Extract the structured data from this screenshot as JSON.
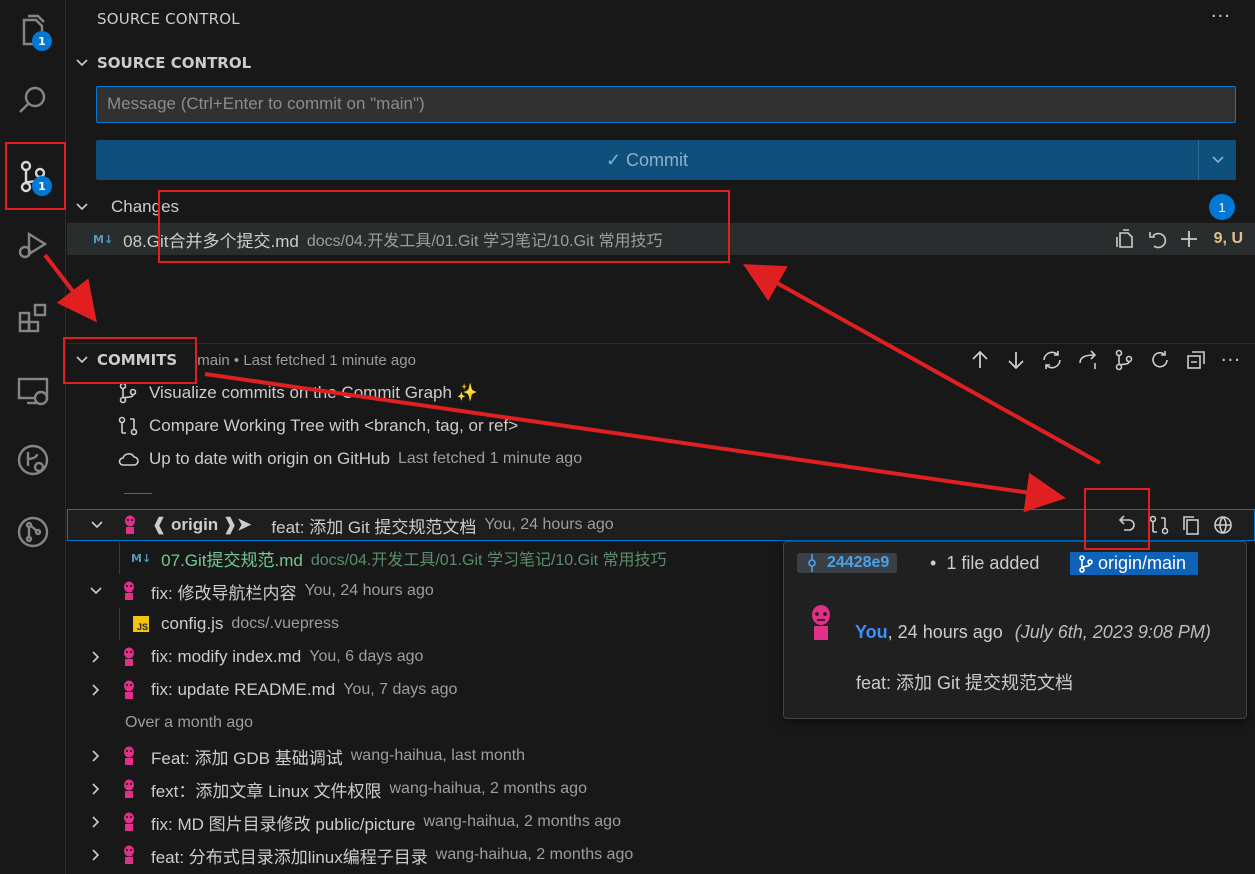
{
  "activity_bar": {
    "items": [
      {
        "icon": "files-icon",
        "badge": "1"
      },
      {
        "icon": "search-icon"
      },
      {
        "icon": "source-control-icon",
        "badge": "1"
      },
      {
        "icon": "run-debug-icon"
      },
      {
        "icon": "extensions-icon"
      },
      {
        "icon": "remote-explorer-icon"
      },
      {
        "icon": "gitlens-inspect-icon"
      },
      {
        "icon": "gitlens-icon"
      }
    ]
  },
  "view": {
    "title": "SOURCE CONTROL",
    "more": "···"
  },
  "scm": {
    "section_title": "SOURCE CONTROL",
    "message_placeholder": "Message (Ctrl+Enter to commit on \"main\")",
    "commit_label": "✓ Commit",
    "changes_label": "Changes",
    "changes_count": "1",
    "changed_file": {
      "name": "08.Git合并多个提交.md",
      "path": "docs/04.开发工具/01.Git 学习笔记/10.Git 常用技巧",
      "status": "9, U",
      "icon_text": "M↓"
    }
  },
  "commits": {
    "section_title": "COMMITS",
    "subtitle": "main • Last fetched 1 minute ago",
    "actions": [
      {
        "label": "Visualize commits on the Commit Graph ✨",
        "icon": "graph-icon"
      },
      {
        "label": "Compare Working Tree with <branch, tag, or ref>",
        "icon": "compare-icon"
      },
      {
        "label": "Up to date with origin on GitHub",
        "detail": "Last fetched 1 minute ago",
        "icon": "cloud-icon"
      }
    ],
    "separator": "——",
    "items": [
      {
        "branch": "❰ origin ❱➤",
        "message": "feat: 添加 Git 提交规范文档",
        "meta": "You, 24 hours ago",
        "expanded": true
      },
      {
        "file": "07.Git提交规范.md",
        "path": "docs/04.开发工具/01.Git 学习笔记/10.Git 常用技巧",
        "icon_text": "M↓"
      },
      {
        "message": "fix: 修改导航栏内容",
        "meta": "You, 24 hours ago",
        "expanded": true
      },
      {
        "file": "config.js",
        "path": "docs/.vuepress",
        "icon_text": "JS"
      },
      {
        "message": "fix: modify index.md",
        "meta": "You, 6 days ago"
      },
      {
        "message": "fix: update README.md",
        "meta": "You, 7 days ago"
      },
      {
        "group": "Over a month ago"
      },
      {
        "message": "Feat: 添加 GDB 基础调试",
        "meta": "wang-haihua, last month"
      },
      {
        "message": "fext：添加文章 Linux 文件权限",
        "meta": "wang-haihua, 2 months ago"
      },
      {
        "message": "fix: MD 图片目录修改 public/picture",
        "meta": "wang-haihua, 2 months ago"
      },
      {
        "message": "feat: 分布式目录添加linux编程子目录",
        "meta": "wang-haihua, 2 months ago"
      }
    ]
  },
  "tooltip": {
    "sha": "24428e9",
    "files": "1 file added",
    "branch": "origin/main",
    "author": "You",
    "time": ", 24 hours ago",
    "date": "(July 6th, 2023 9:08 PM)",
    "message": "feat: 添加 Git 提交规范文档"
  },
  "colors": {
    "accent": "#0078d4",
    "annotation": "#e02020",
    "modified": "#e2c08d",
    "added_file": "#73c991"
  }
}
